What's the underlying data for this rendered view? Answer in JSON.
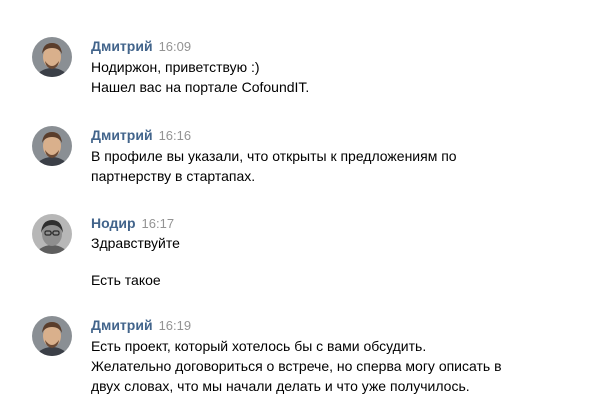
{
  "chat": {
    "messages": [
      {
        "author": "Дмитрий",
        "time": "16:09",
        "avatar": "dmitry-photo",
        "lines": [
          "Нодиржон, приветствую :)",
          "Нашел вас на портале CofoundIT."
        ]
      },
      {
        "author": "Дмитрий",
        "time": "16:16",
        "avatar": "dmitry-photo",
        "lines": [
          "В профиле вы указали, что открыты к предложениям по",
          "партнерству в стартапах."
        ]
      },
      {
        "author": "Нодир",
        "time": "16:17",
        "avatar": "nodir-photo",
        "lines": [
          "Здравствуйте",
          "Есть такое"
        ]
      },
      {
        "author": "Дмитрий",
        "time": "16:19",
        "avatar": "dmitry-photo",
        "lines": [
          "Есть проект, который хотелось бы с вами обсудить.",
          "Желательно договориться о встрече, но сперва могу описать в",
          "двух словах, что мы начали делать и что уже получилось."
        ]
      }
    ]
  },
  "colors": {
    "author": "#42648b",
    "time": "#939393",
    "text": "#000000"
  }
}
